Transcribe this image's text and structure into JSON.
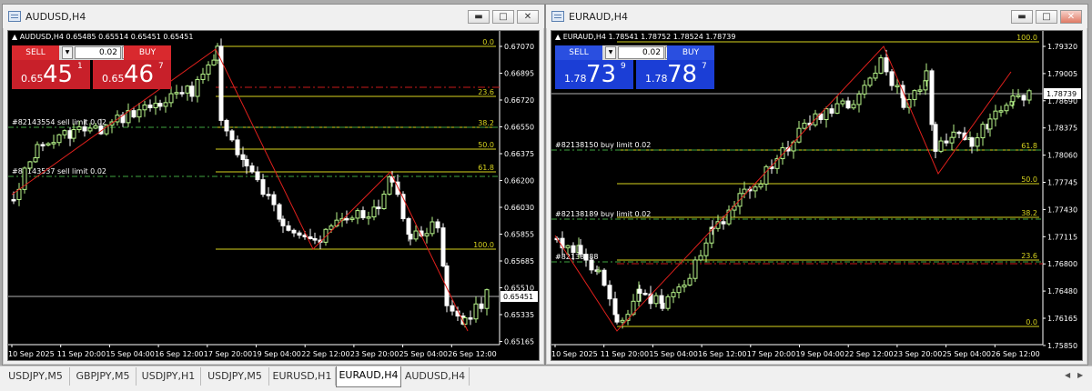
{
  "windows": [
    {
      "id": "aud",
      "title": "AUDUSD,H4",
      "info_arrow": "▲",
      "info": "AUDUSD,H4  0.65485 0.65514 0.65451 0.65451",
      "trade": {
        "sell_label": "SELL",
        "buy_label": "BUY",
        "lot": "0.02",
        "sell_prefix": "0.65",
        "sell_big": "45",
        "sell_sup": "1",
        "buy_prefix": "0.65",
        "buy_big": "46",
        "buy_sup": "7",
        "color": "#d9292e"
      },
      "price_labels": [
        "0.67070",
        "0.66895",
        "0.66720",
        "0.66550",
        "0.66375",
        "0.66200",
        "0.66030",
        "0.65855",
        "0.65685",
        "0.65510",
        "0.65335",
        "0.65165"
      ],
      "current_price": "0.65451",
      "time_labels": [
        "10 Sep 2025",
        "11 Sep 20:00",
        "15 Sep 04:00",
        "16 Sep 12:00",
        "17 Sep 20:00",
        "19 Sep 04:00",
        "22 Sep 12:00",
        "23 Sep 20:00",
        "25 Sep 04:00",
        "26 Sep 12:00"
      ],
      "fib_levels": [
        "0.0",
        "23.6",
        "38.2",
        "50.0",
        "61.8",
        "100.0"
      ],
      "orders": [
        "#82143554 sell limit 0.02",
        "#82143537 sell limit 0.02"
      ]
    },
    {
      "id": "eur",
      "title": "EURAUD,H4",
      "info_arrow": "▲",
      "info": "EURAUD,H4  1.78541 1.78752 1.78524 1.78739",
      "trade": {
        "sell_label": "SELL",
        "buy_label": "BUY",
        "lot": "0.02",
        "sell_prefix": "1.78",
        "sell_big": "73",
        "sell_sup": "9",
        "buy_prefix": "1.78",
        "buy_big": "78",
        "buy_sup": "7",
        "color": "#1b3ed6"
      },
      "price_labels": [
        "1.79320",
        "1.79005",
        "1.78690",
        "1.78375",
        "1.78060",
        "1.77745",
        "1.77430",
        "1.77115",
        "1.76800",
        "1.76480",
        "1.76165",
        "1.75850"
      ],
      "current_price": "1.78739",
      "time_labels": [
        "10 Sep 2025",
        "11 Sep 20:00",
        "15 Sep 04:00",
        "16 Sep 12:00",
        "17 Sep 20:00",
        "19 Sep 04:00",
        "22 Sep 12:00",
        "23 Sep 20:00",
        "25 Sep 04:00",
        "26 Sep 12:00"
      ],
      "fib_levels": [
        "100.0",
        "61.8",
        "50.0",
        "38.2",
        "23.6",
        "0.0"
      ],
      "orders": [
        "#82138150 buy limit 0.02",
        "#82138189 buy limit 0.02",
        "#82138188"
      ]
    }
  ],
  "tabs": [
    "USDJPY,M5",
    "GBPJPY,M5",
    "USDJPY,H1",
    "USDJPY,M5",
    "EURUSD,H1",
    "EURAUD,H4",
    "AUDUSD,H4"
  ],
  "active_tab": 5,
  "window_buttons": {
    "minimize": "▬",
    "maximize": "□",
    "close": "✕"
  },
  "tab_nav": {
    "left": "◀",
    "right": "▶"
  },
  "colors": {
    "bull": "#b7f58a",
    "bear": "#ffffff",
    "fib": "#d7d31e",
    "zigzag": "#e0201c",
    "chart_bg": "#000000"
  }
}
